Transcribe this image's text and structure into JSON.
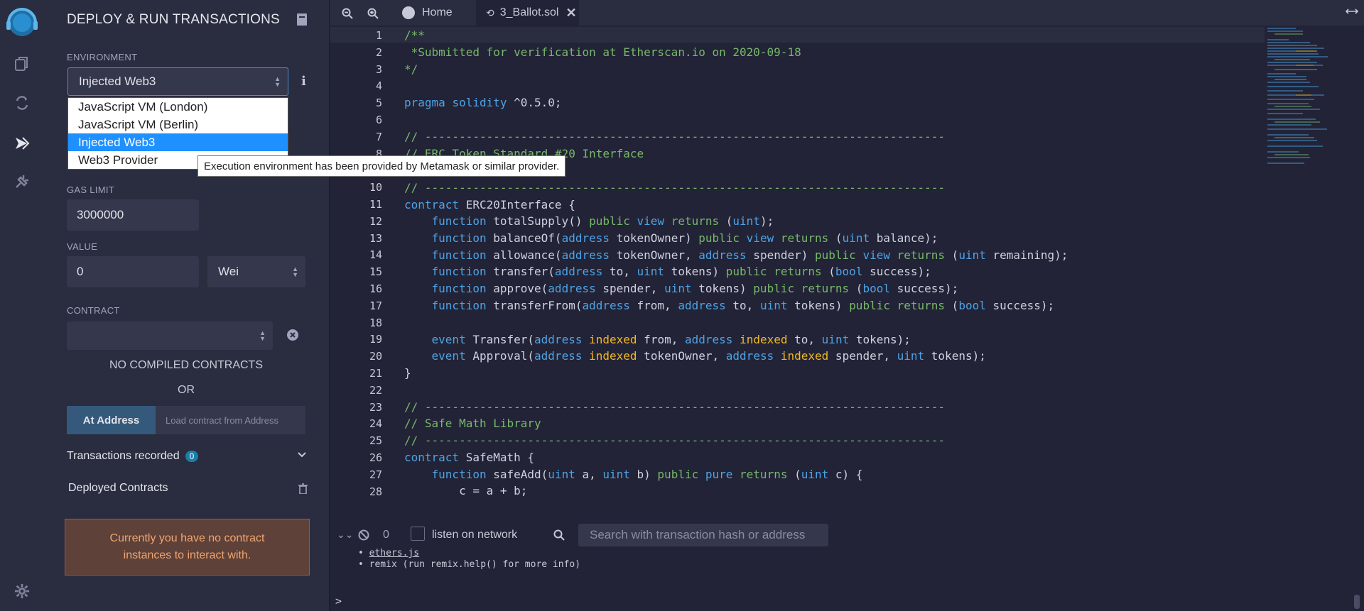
{
  "panel": {
    "title": "DEPLOY & RUN TRANSACTIONS",
    "environment_label": "ENVIRONMENT",
    "environment_value": "Injected Web3",
    "environment_options": [
      "JavaScript VM (London)",
      "JavaScript VM (Berlin)",
      "Injected Web3",
      "Web3 Provider"
    ],
    "tooltip": "Execution environment has been provided by Metamask or similar provider.",
    "gas_limit_label": "GAS LIMIT",
    "gas_limit_value": "3000000",
    "value_label": "VALUE",
    "value_value": "0",
    "value_unit": "Wei",
    "contract_label": "CONTRACT",
    "no_compiled": "NO COMPILED CONTRACTS",
    "or": "OR",
    "at_address_button": "At Address",
    "load_placeholder": "Load contract from Address",
    "transactions_recorded": "Transactions recorded",
    "transactions_count": "0",
    "deployed_contracts": "Deployed Contracts",
    "no_instances_line1": "Currently you have no contract",
    "no_instances_line2": "instances to interact with."
  },
  "tabs": {
    "home": "Home",
    "file": "3_Ballot.sol"
  },
  "editor": {
    "line_numbers": [
      "1",
      "2",
      "3",
      "4",
      "5",
      "6",
      "7",
      "8",
      "9",
      "10",
      "11",
      "12",
      "13",
      "14",
      "15",
      "16",
      "17",
      "18",
      "19",
      "20",
      "21",
      "22",
      "23",
      "24",
      "25",
      "26",
      "27",
      "28"
    ]
  },
  "terminal": {
    "count": "0",
    "listen_label": "listen on network",
    "search_placeholder": "Search with transaction hash or address",
    "line1": "ethers.js",
    "line2": "remix (run remix.help() for more info)",
    "prompt": ">"
  },
  "colors": {
    "background": "#222336",
    "panel": "#2a2c3f",
    "keyword": "#4ea3e6",
    "comment": "#78b86a",
    "indexed": "#f5b820",
    "accent": "#1a7fa8",
    "warning_text": "#f0a56f"
  }
}
